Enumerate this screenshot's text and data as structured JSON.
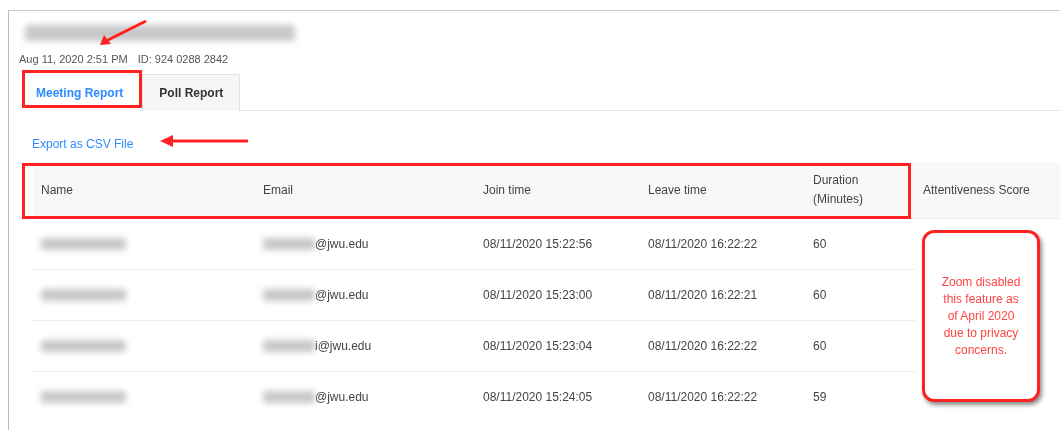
{
  "meeting": {
    "date": "Aug 11, 2020 2:51 PM",
    "meeting_id": "ID: 924 0288 2842"
  },
  "tabs": [
    {
      "label": "Meeting Report",
      "selected": true
    },
    {
      "label": "Poll Report",
      "selected": false
    }
  ],
  "export_link": "Export as CSV File",
  "table": {
    "columns": [
      "Name",
      "Email",
      "Join time",
      "Leave time",
      "Duration (Minutes)",
      "Attentiveness Score"
    ],
    "rows": [
      {
        "email": "@jwu.edu",
        "join_time": "08/11/2020 15:22:56",
        "leave_time": "08/11/2020 16:22:22",
        "duration": "60"
      },
      {
        "email": "@jwu.edu",
        "join_time": "08/11/2020 15:23:00",
        "leave_time": "08/11/2020 16:22:21",
        "duration": "60"
      },
      {
        "email": "i@jwu.edu",
        "join_time": "08/11/2020 15:23:04",
        "leave_time": "08/11/2020 16:22:22",
        "duration": "60"
      },
      {
        "email": "@jwu.edu",
        "join_time": "08/11/2020 15:24:05",
        "leave_time": "08/11/2020 16:22:22",
        "duration": "59"
      }
    ]
  },
  "callout": "Zoom disabled this feature as of April 2020 due to privacy concerns."
}
